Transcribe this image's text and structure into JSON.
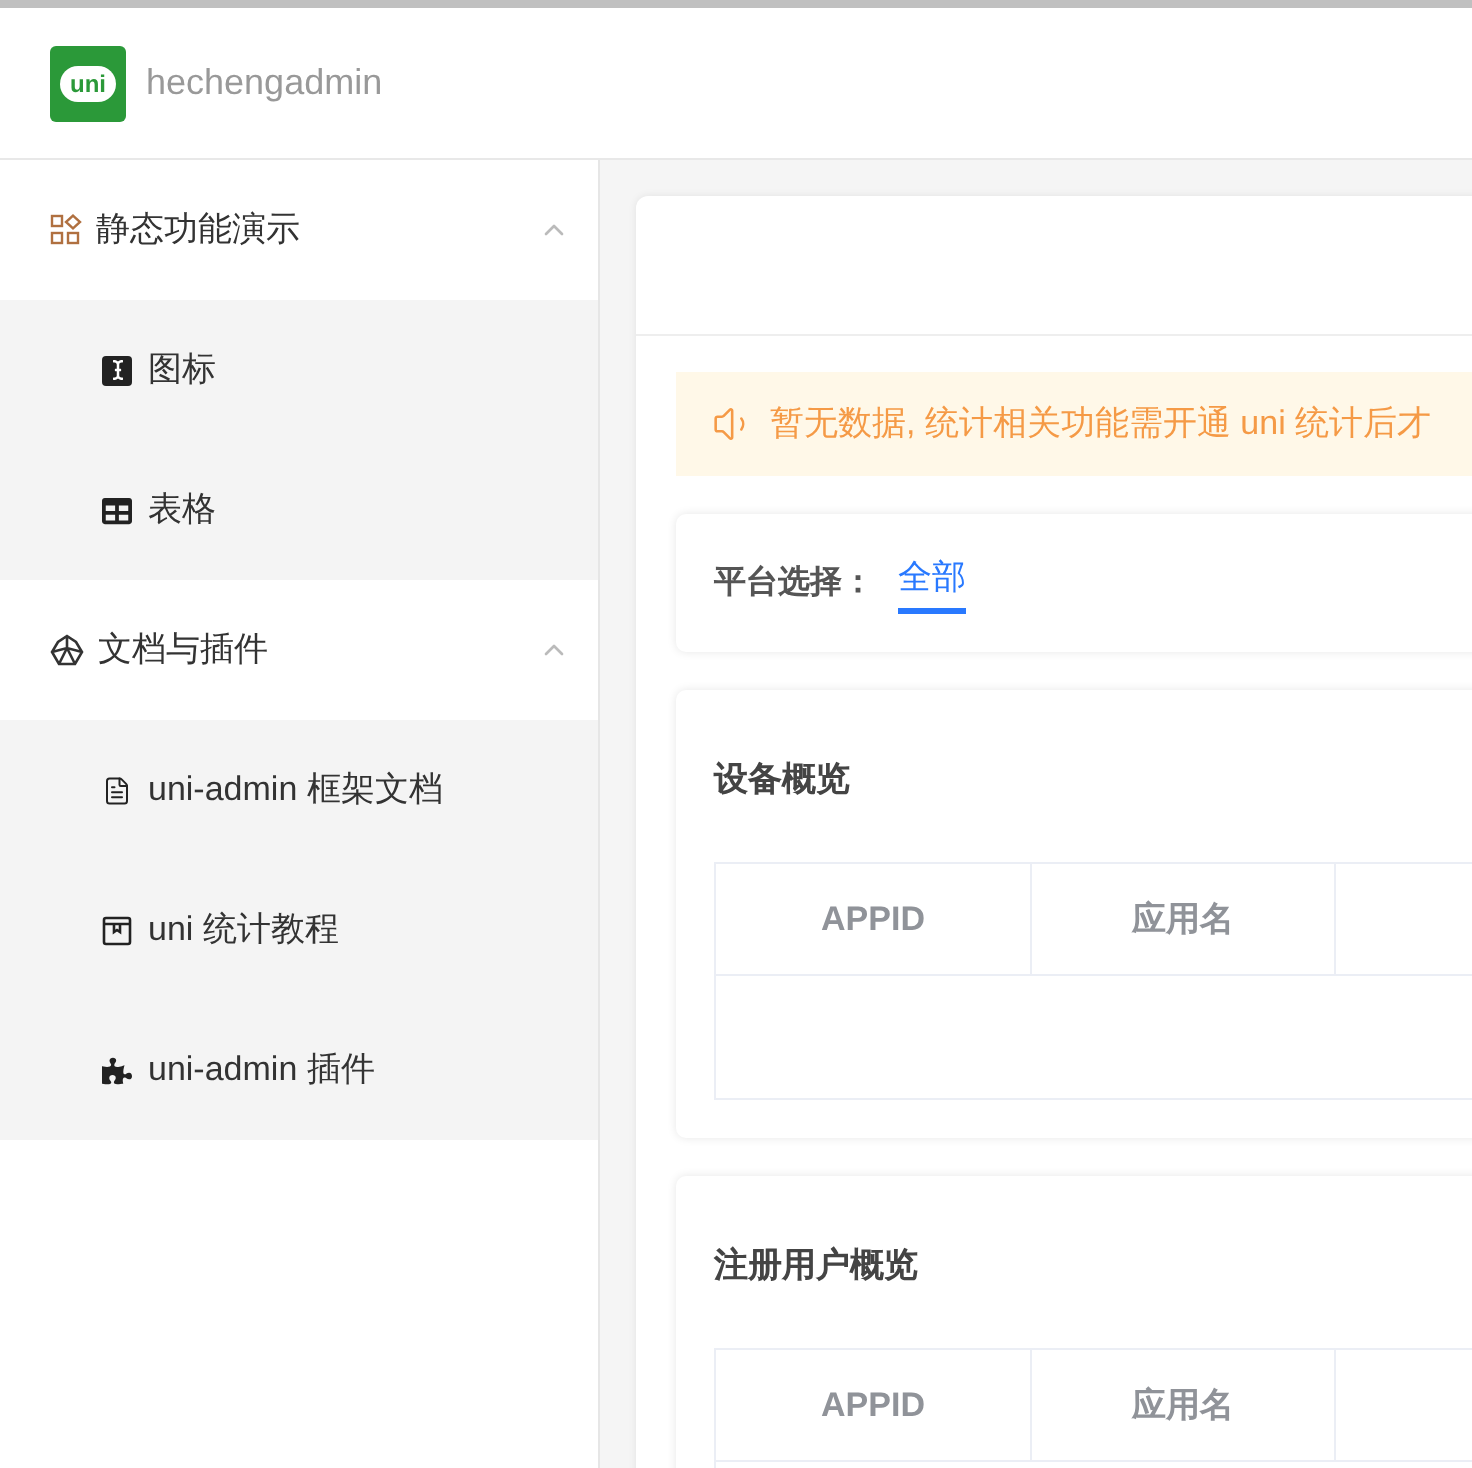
{
  "header": {
    "logo_text": "uni",
    "app_name": "hechengadmin"
  },
  "sidebar": {
    "groups": [
      {
        "label": "静态功能演示",
        "expanded": true,
        "children": [
          {
            "label": "图标"
          },
          {
            "label": "表格"
          }
        ]
      },
      {
        "label": "文档与插件",
        "expanded": true,
        "children": [
          {
            "label": "uni-admin 框架文档"
          },
          {
            "label": "uni 统计教程"
          },
          {
            "label": "uni-admin 插件"
          }
        ]
      }
    ]
  },
  "main": {
    "notice": "暂无数据, 统计相关功能需开通 uni 统计后才",
    "platform": {
      "label": "平台选择：",
      "options": [
        {
          "label": "全部",
          "selected": true
        }
      ]
    },
    "sections": [
      {
        "title": "设备概览",
        "columns": [
          "APPID",
          "应用名"
        ]
      },
      {
        "title": "注册用户概览",
        "columns": [
          "APPID",
          "应用名"
        ]
      }
    ]
  }
}
